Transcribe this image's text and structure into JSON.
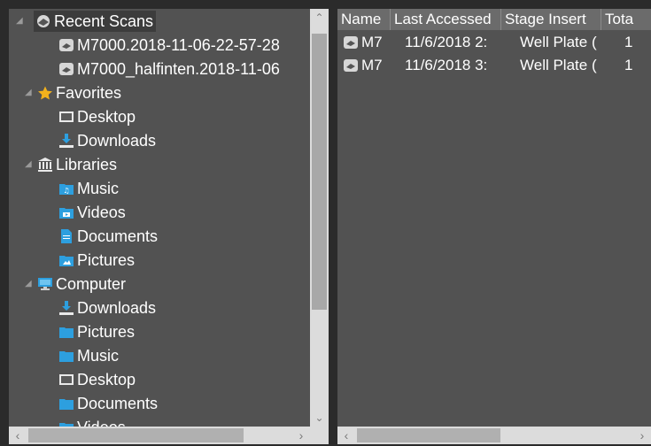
{
  "tree": {
    "items": [
      {
        "label": "Recent Scans",
        "icon": "scan-icon",
        "level": 0,
        "expanded": true,
        "selected": true
      },
      {
        "label": "M7000.2018-11-06-22-57-28",
        "icon": "scan-file-icon",
        "level": 1
      },
      {
        "label": "M7000_halfinten.2018-11-06",
        "icon": "scan-file-icon",
        "level": 1
      },
      {
        "label": "Favorites",
        "icon": "star-icon",
        "level": 0,
        "expanded": true
      },
      {
        "label": "Desktop",
        "icon": "desktop-icon",
        "level": 1
      },
      {
        "label": "Downloads",
        "icon": "download-icon",
        "level": 1
      },
      {
        "label": "Libraries",
        "icon": "library-icon",
        "level": 0,
        "expanded": true
      },
      {
        "label": "Music",
        "icon": "music-folder-icon",
        "level": 1
      },
      {
        "label": "Videos",
        "icon": "video-folder-icon",
        "level": 1
      },
      {
        "label": "Documents",
        "icon": "document-icon",
        "level": 1
      },
      {
        "label": "Pictures",
        "icon": "pictures-folder-icon",
        "level": 1
      },
      {
        "label": "Computer",
        "icon": "computer-icon",
        "level": 0,
        "expanded": true
      },
      {
        "label": "Downloads",
        "icon": "download-icon",
        "level": 1
      },
      {
        "label": "Pictures",
        "icon": "folder-icon",
        "level": 1
      },
      {
        "label": "Music",
        "icon": "folder-icon",
        "level": 1
      },
      {
        "label": "Desktop",
        "icon": "desktop-icon",
        "level": 1
      },
      {
        "label": "Documents",
        "icon": "folder-icon",
        "level": 1
      },
      {
        "label": "Videos",
        "icon": "folder-icon",
        "level": 1
      }
    ]
  },
  "list": {
    "columns": [
      "Name",
      "Last Accessed",
      "Stage Insert",
      "Tota"
    ],
    "rows": [
      {
        "name": "M7",
        "last_accessed": "11/6/2018 2:",
        "stage_insert": "Well Plate (",
        "total": "1"
      },
      {
        "name": "M7",
        "last_accessed": "11/6/2018 3:",
        "stage_insert": "Well Plate (",
        "total": "1"
      }
    ]
  },
  "colors": {
    "pane_background": "#525252",
    "header_background": "#6b6b6b",
    "scrollbar": "#dcdcdc",
    "favorites_star": "#f3b21c",
    "folder_blue": "#2d9fdf"
  }
}
